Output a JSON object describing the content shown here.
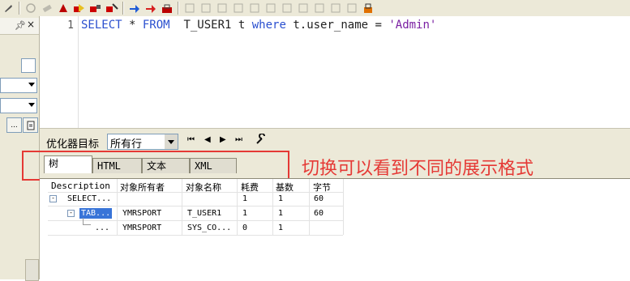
{
  "toolbar": {
    "icons": [
      "settings-icon",
      "refresh-icon",
      "erase-icon",
      "stop-icon",
      "run-icon",
      "run-all-icon",
      "debug-icon",
      "up-arrow-icon",
      "right-arrow-icon",
      "lock-icon",
      "explain-icon",
      "plan-icon",
      "format-icon",
      "indent-icon",
      "outdent-icon",
      "comment-icon",
      "uncomment-icon",
      "bookmark-icon",
      "find-icon",
      "replace-icon",
      "save-icon",
      "commit-icon"
    ]
  },
  "left_panel": {
    "pin_label": "P",
    "close_label": "×",
    "small_button": "..."
  },
  "editor": {
    "line_number": "1",
    "tokens": {
      "select": "SELECT",
      "star": " * ",
      "from": "FROM",
      "table": "  T_USER1 t ",
      "where": "where",
      "cond": " t.user_name = ",
      "value": "'Admin'"
    }
  },
  "optimizer": {
    "label": "优化器目标",
    "selected": "所有行"
  },
  "tabs": [
    {
      "label": "树"
    },
    {
      "label": "HTML"
    },
    {
      "label": "文本"
    },
    {
      "label": "XML"
    }
  ],
  "annotation": "切换可以看到不同的展示格式",
  "plan_grid": {
    "headers": [
      "Description",
      "对象所有者",
      "对象名称",
      "耗费",
      "基数",
      "字节"
    ],
    "rows": [
      {
        "description": "SELECT...",
        "owner": "",
        "object": "",
        "cost": "1",
        "cardinality": "1",
        "bytes": "60"
      },
      {
        "description": "TAB...",
        "owner": "YMRSPORT",
        "object": "T_USER1",
        "cost": "1",
        "cardinality": "1",
        "bytes": "60"
      },
      {
        "description": "...",
        "owner": "YMRSPORT",
        "object": "SYS_CO...",
        "cost": "0",
        "cardinality": "1",
        "bytes": ""
      }
    ]
  },
  "colors": {
    "keyword": "#2a4fcf",
    "string": "#7a1fa2",
    "annotation": "#e53935",
    "selection": "#3874d8"
  }
}
